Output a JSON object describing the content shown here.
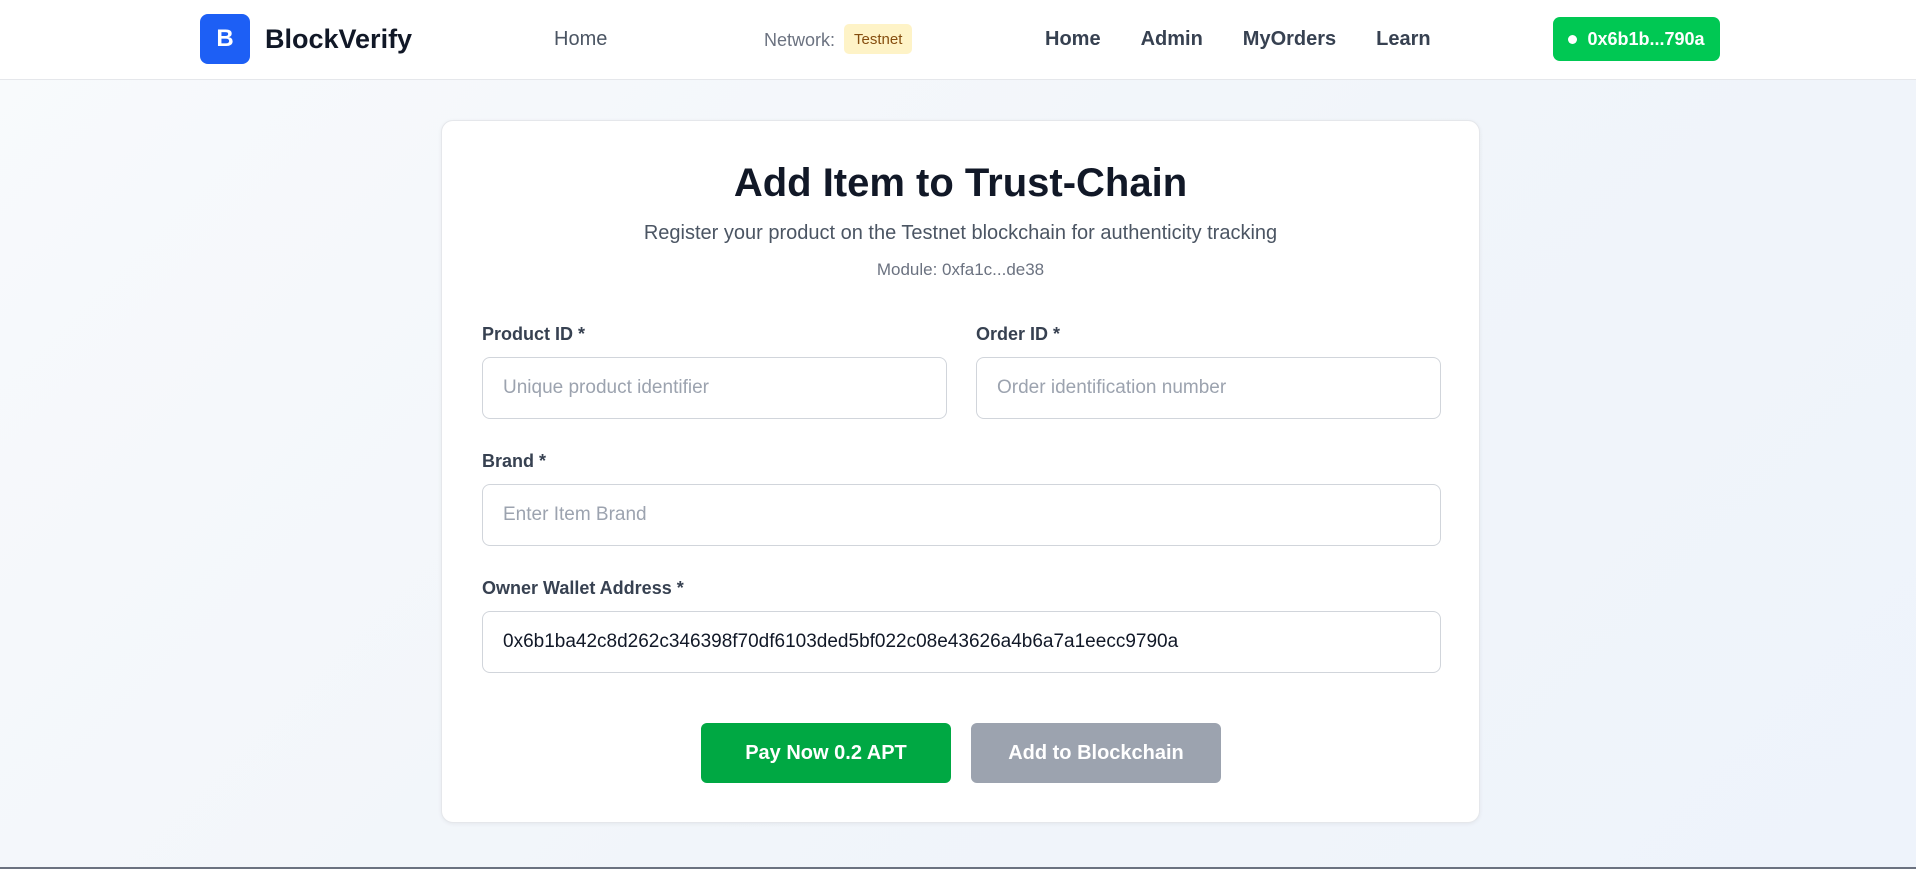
{
  "navbar": {
    "logo_letter": "B",
    "brand": "BlockVerify",
    "home_left": "Home",
    "network_label": "Network:",
    "network_value": "Testnet",
    "links": [
      "Home",
      "Admin",
      "MyOrders",
      "Learn"
    ],
    "wallet": "0x6b1b...790a"
  },
  "form": {
    "title": "Add Item to Trust-Chain",
    "subtitle": "Register your product on the Testnet blockchain for authenticity tracking",
    "module": "Module: 0xfa1c...de38",
    "product_id": {
      "label": "Product ID *",
      "placeholder": "Unique product identifier",
      "value": ""
    },
    "order_id": {
      "label": "Order ID *",
      "placeholder": "Order identification number",
      "value": ""
    },
    "brand": {
      "label": "Brand *",
      "placeholder": "Enter Item Brand",
      "value": ""
    },
    "owner_wallet": {
      "label": "Owner Wallet Address *",
      "placeholder": "",
      "value": "0x6b1ba42c8d262c346398f70df6103ded5bf022c08e43626a4b6a7a1eecc9790a"
    },
    "pay_button": "Pay Now 0.2 APT",
    "add_button": "Add to Blockchain"
  },
  "colors": {
    "primary_blue": "#1d5ff5",
    "wallet_green": "#00c853",
    "pay_green": "#00a843",
    "disabled_gray": "#9ca3af",
    "testnet_badge_bg": "#fef3c7"
  }
}
